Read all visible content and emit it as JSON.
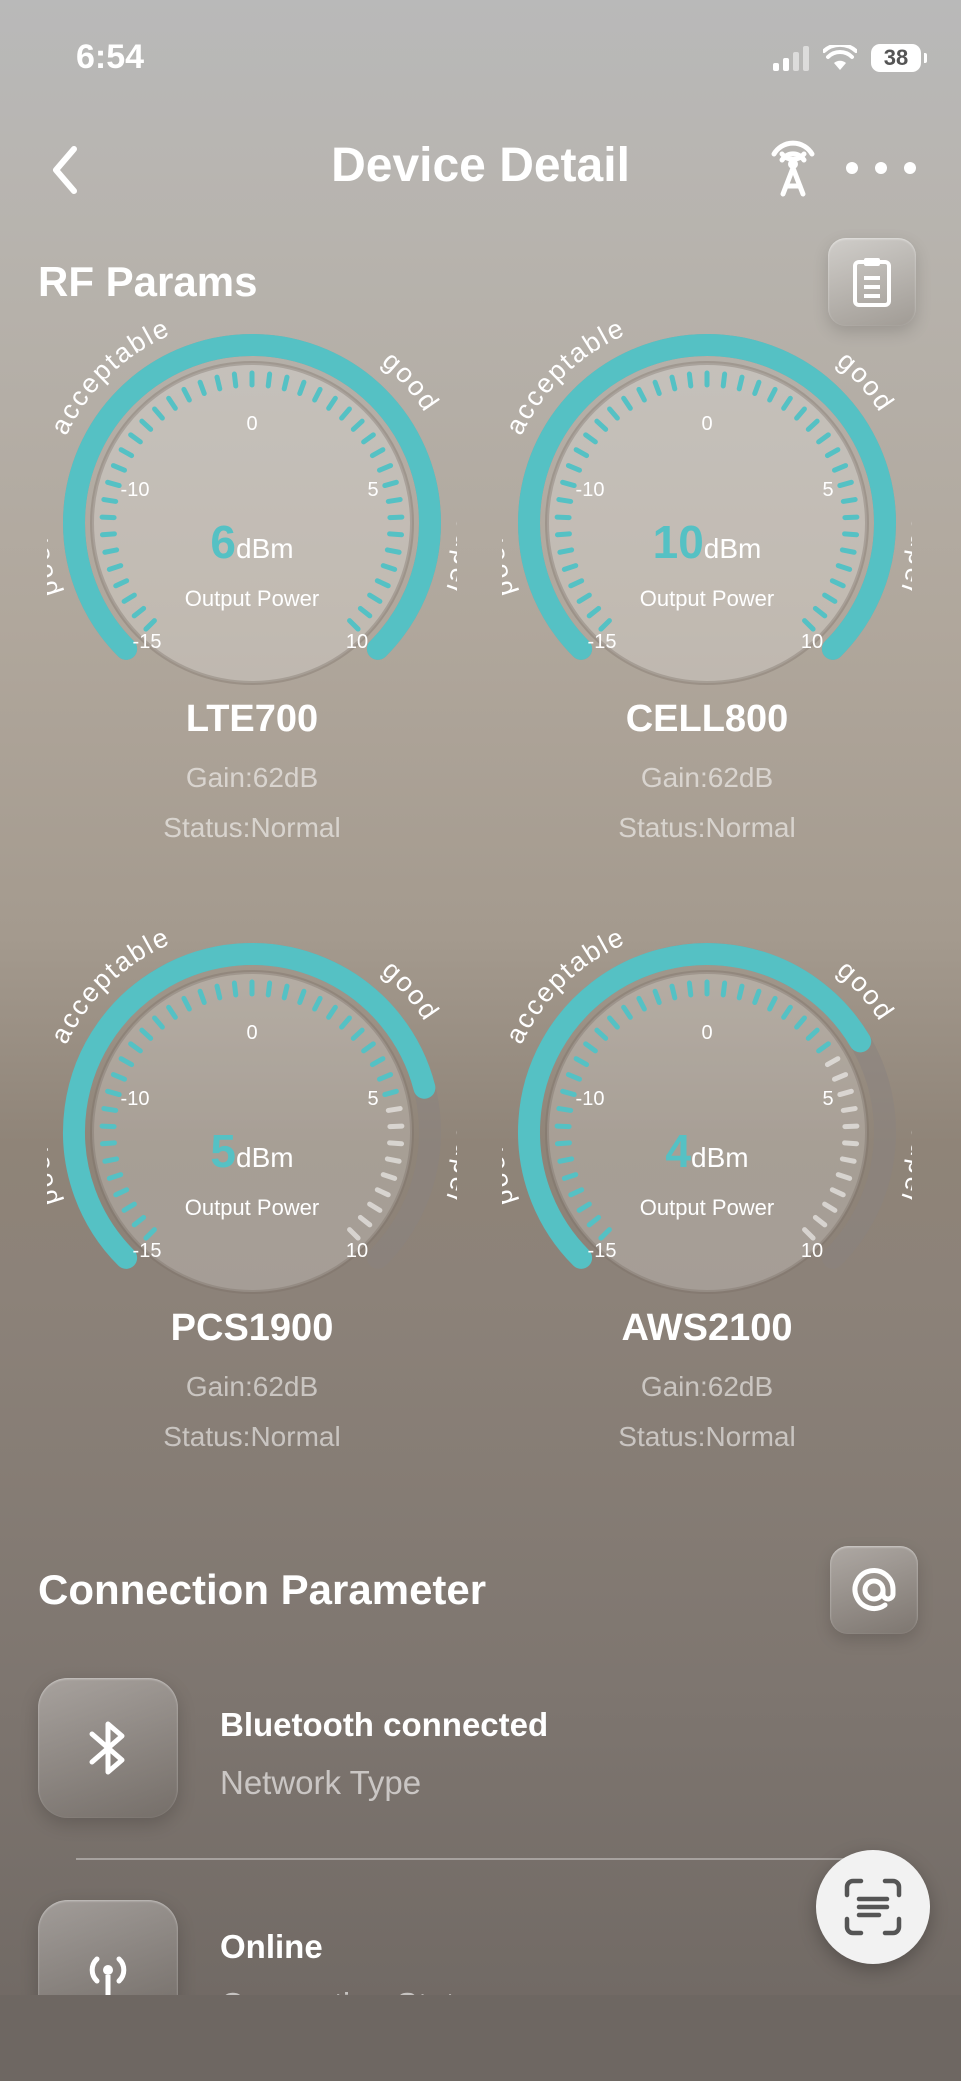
{
  "status_bar": {
    "time": "6:54",
    "battery": "38"
  },
  "header": {
    "title": "Device Detail"
  },
  "rf_params": {
    "title": "RF Params",
    "zone_labels": {
      "poor": "poor",
      "acceptable": "acceptable",
      "good": "good",
      "super": "super"
    },
    "ticks": [
      "-15",
      "-10",
      "0",
      "5",
      "10"
    ],
    "unit": "dBm",
    "caption": "Output Power",
    "bands": [
      {
        "name": "LTE700",
        "value": "6",
        "level": 1.0,
        "gain": "Gain:62dB",
        "status": "Status:Normal"
      },
      {
        "name": "CELL800",
        "value": "10",
        "level": 1.0,
        "gain": "Gain:62dB",
        "status": "Status:Normal"
      },
      {
        "name": "PCS1900",
        "value": "5",
        "level": 0.78,
        "gain": "Gain:62dB",
        "status": "Status:Normal"
      },
      {
        "name": "AWS2100",
        "value": "4",
        "level": 0.72,
        "gain": "Gain:62dB",
        "status": "Status:Normal"
      }
    ]
  },
  "connection": {
    "title": "Connection Parameter",
    "items": [
      {
        "main": "Bluetooth connected",
        "sub": "Network Type",
        "icon": "bluetooth-icon"
      },
      {
        "main": "Online",
        "sub": "Connection Status",
        "icon": "antenna-icon"
      }
    ]
  },
  "colors": {
    "accent": "#55c1c4",
    "track": "#8a8480"
  }
}
